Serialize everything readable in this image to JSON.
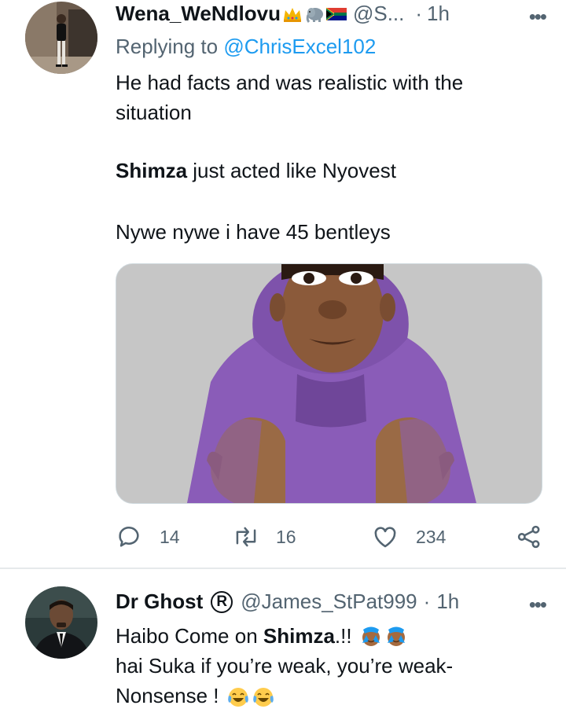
{
  "tweet1": {
    "display_name": "Wena_WeNdlovu",
    "handle": "@S...",
    "separator": "·",
    "time": "1h",
    "more": "•••",
    "replying_prefix": "Replying to",
    "replying_to": "@ChrisExcel102",
    "line1": "He had facts and was realistic with the situation",
    "line2_bold": "Shimza",
    "line2_rest": " just acted like Nyovest",
    "line3": "Nywe nywe i have 45 bentleys",
    "stats": {
      "replies": "14",
      "retweets": "16",
      "likes": "234"
    }
  },
  "tweet2": {
    "display_name": "Dr Ghost",
    "badge": "R",
    "handle": "@James_StPat999",
    "separator": "·",
    "time": "1h",
    "more": "•••",
    "line1_pre": "Haibo Come on ",
    "line1_bold": "Shimza",
    "line1_post": ".!!",
    "line2": "hai Suka if you’re weak, you’re weak-",
    "line3": "Nonsense !"
  },
  "icons": [
    "crown-emoji",
    "elephant-emoji",
    "south-africa-flag-emoji",
    "reply-icon",
    "retweet-icon",
    "like-icon",
    "share-icon",
    "facepalm-emoji",
    "laughing-emoji"
  ],
  "colors": {
    "text": "#0f1419",
    "secondary": "#536471",
    "link": "#1d9bf0",
    "hoodie": "#8a5cb8"
  }
}
